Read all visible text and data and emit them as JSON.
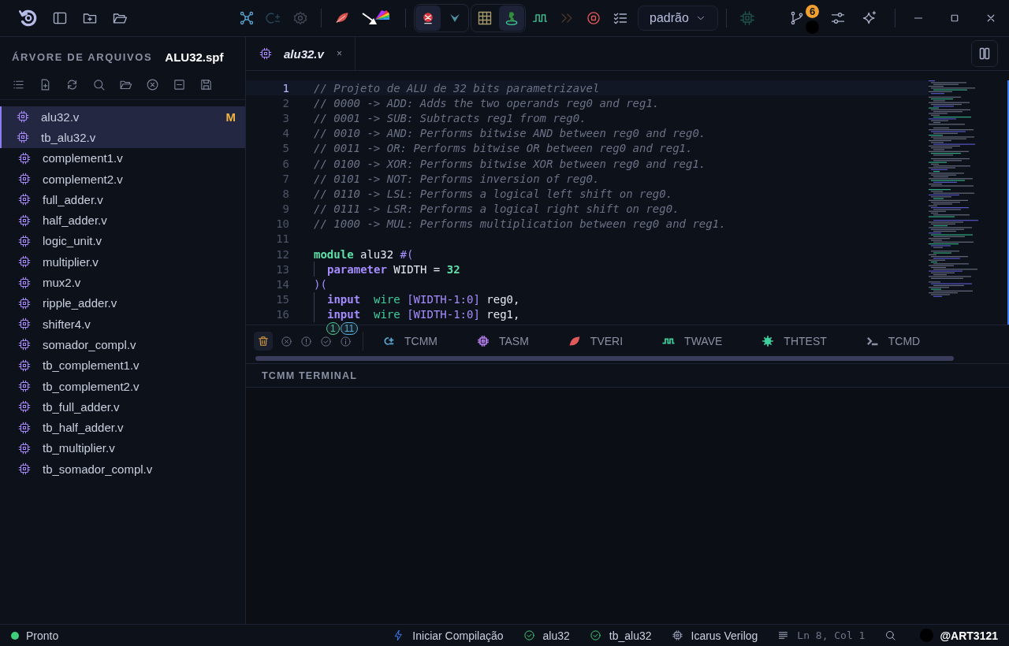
{
  "toolbar": {
    "tools": [
      {
        "disabled": false
      },
      {
        "disabled": true
      },
      {
        "disabled": true
      },
      {
        "disabled": false
      },
      {
        "disabled": false
      },
      {
        "disabled": false
      },
      {
        "disabled": true
      },
      {
        "disabled": false
      },
      {
        "disabled": false
      },
      {
        "disabled": true
      },
      {
        "disabled": false
      },
      {
        "disabled": false
      },
      {
        "disabled": false
      }
    ],
    "toggles": [
      {
        "selected": true
      },
      {
        "selected": false
      },
      {
        "selected": false
      },
      {
        "selected": true
      }
    ],
    "mode": "padrão",
    "git_badge": "6"
  },
  "sidebar": {
    "title": "ÁRVORE DE ARQUIVOS",
    "project": "ALU32.spf",
    "files": [
      {
        "name": "alu32.v",
        "selected": true,
        "badge": "M"
      },
      {
        "name": "tb_alu32.v",
        "selected": true
      },
      {
        "name": "complement1.v",
        "selected": false
      },
      {
        "name": "complement2.v",
        "selected": false
      },
      {
        "name": "full_adder.v",
        "selected": false
      },
      {
        "name": "half_adder.v",
        "selected": false
      },
      {
        "name": "logic_unit.v",
        "selected": false
      },
      {
        "name": "multiplier.v",
        "selected": false
      },
      {
        "name": "mux2.v",
        "selected": false
      },
      {
        "name": "ripple_adder.v",
        "selected": false
      },
      {
        "name": "shifter4.v",
        "selected": false
      },
      {
        "name": "somador_compl.v",
        "selected": false
      },
      {
        "name": "tb_complement1.v",
        "selected": false
      },
      {
        "name": "tb_complement2.v",
        "selected": false
      },
      {
        "name": "tb_full_adder.v",
        "selected": false
      },
      {
        "name": "tb_half_adder.v",
        "selected": false
      },
      {
        "name": "tb_multiplier.v",
        "selected": false
      },
      {
        "name": "tb_somador_compl.v",
        "selected": false
      }
    ]
  },
  "editor": {
    "tabs": [
      {
        "label": "alu32.v",
        "selected": true,
        "close": "×"
      }
    ],
    "lines": [
      {
        "number": "1",
        "current": true,
        "tokens": [
          {
            "kind": "comment",
            "text": "// Projeto de ALU de 32 bits parametrizavel"
          }
        ]
      },
      {
        "number": "2",
        "current": false,
        "tokens": [
          {
            "kind": "comment",
            "text": "// 0000 -> ADD: Adds the two operands reg0 and reg1."
          }
        ]
      },
      {
        "number": "3",
        "current": false,
        "tokens": [
          {
            "kind": "comment",
            "text": "// 0001 -> SUB: Subtracts reg1 from reg0."
          }
        ]
      },
      {
        "number": "4",
        "current": false,
        "tokens": [
          {
            "kind": "comment",
            "text": "// 0010 -> AND: Performs bitwise AND between reg0 and reg0."
          }
        ]
      },
      {
        "number": "5",
        "current": false,
        "tokens": [
          {
            "kind": "comment",
            "text": "// 0011 -> OR: Performs bitwise OR between reg0 and reg1."
          }
        ]
      },
      {
        "number": "6",
        "current": false,
        "tokens": [
          {
            "kind": "comment",
            "text": "// 0100 -> XOR: Performs bitwise XOR between reg0 and reg1."
          }
        ]
      },
      {
        "number": "7",
        "current": false,
        "tokens": [
          {
            "kind": "comment",
            "text": "// 0101 -> NOT: Performs inversion of reg0."
          }
        ]
      },
      {
        "number": "8",
        "current": false,
        "tokens": [
          {
            "kind": "comment",
            "text": "// 0110 -> LSL: Performs a logical left shift on reg0."
          }
        ]
      },
      {
        "number": "9",
        "current": false,
        "tokens": [
          {
            "kind": "comment",
            "text": "// 0111 -> LSR: Performs a logical right shift on reg0."
          }
        ]
      },
      {
        "number": "10",
        "current": false,
        "tokens": [
          {
            "kind": "comment",
            "text": "// 1000 -> MUL: Performs multiplication between reg0 and reg1."
          }
        ]
      },
      {
        "number": "11",
        "current": false
      },
      {
        "number": "12",
        "current": false,
        "tokens": [
          {
            "kind": "module",
            "text": "module"
          },
          {
            "kind": "plain",
            "text": " alu32 "
          },
          {
            "kind": "punct",
            "text": "#("
          }
        ]
      },
      {
        "number": "13",
        "current": false,
        "indent": true,
        "tokens": [
          {
            "kind": "keyword",
            "text": "parameter"
          },
          {
            "kind": "plain",
            "text": " WIDTH = "
          },
          {
            "kind": "number",
            "text": "32"
          }
        ]
      },
      {
        "number": "14",
        "current": false,
        "tokens": [
          {
            "kind": "punct",
            "text": ")("
          }
        ]
      },
      {
        "number": "15",
        "current": false,
        "indent": true,
        "tokens": [
          {
            "kind": "keyword",
            "text": "input"
          },
          {
            "kind": "type",
            "text": "  wire"
          },
          {
            "kind": "range",
            "text": " [WIDTH-1:0]"
          },
          {
            "kind": "plain",
            "text": " reg0,"
          }
        ]
      },
      {
        "number": "16",
        "current": false,
        "indent": true,
        "tokens": [
          {
            "kind": "keyword",
            "text": "input"
          },
          {
            "kind": "type",
            "text": "  wire"
          },
          {
            "kind": "range",
            "text": " [WIDTH-1:0]"
          },
          {
            "kind": "plain",
            "text": " reg1,"
          }
        ]
      }
    ]
  },
  "panel": {
    "counters": [
      {
        "text": "1",
        "color": "#4fc08d"
      },
      {
        "text": "11",
        "color": "#5aa9d6"
      }
    ],
    "tabs": [
      {
        "label": "TCMM",
        "color": "#5aa9d6"
      },
      {
        "label": "TASM",
        "color": "#b07ce8"
      },
      {
        "label": "TVERI",
        "color": "#e05a5a"
      },
      {
        "label": "TWAVE",
        "color": "#3ecf9e"
      },
      {
        "label": "THTEST",
        "color": "#3ecf9e"
      },
      {
        "label": "TCMD",
        "color": "#8a8fa3"
      }
    ],
    "title": "TCMM TERMINAL"
  },
  "status_bar": {
    "status": "Pronto",
    "compile": "Iniciar Compilação",
    "checks": [
      "alu32",
      "tb_alu32"
    ],
    "compiler": "Icarus Verilog",
    "position": "Ln 8, Col 1",
    "user": "@ART3121"
  }
}
